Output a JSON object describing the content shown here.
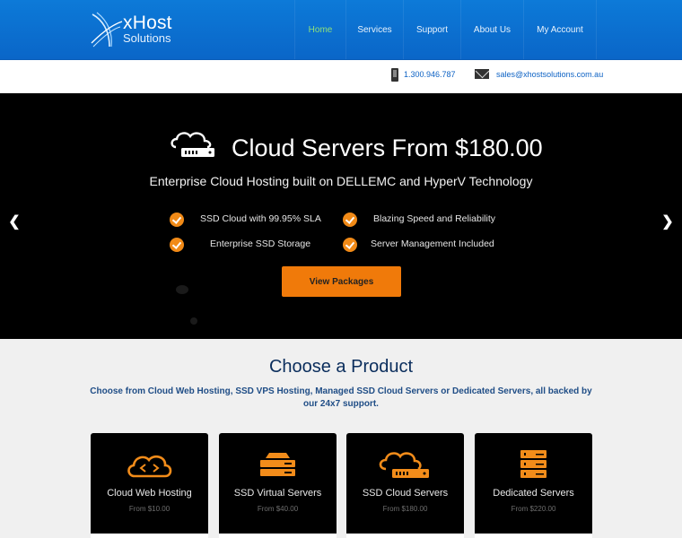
{
  "brand": {
    "name_line1": "xHost",
    "name_line2": "Solutions",
    "logo_icon": "swoosh-logo-icon",
    "primary_color": "#0d72d2",
    "accent_color": "#f07a0a",
    "active_nav_color": "#8fe07a"
  },
  "nav": {
    "items": [
      {
        "label": "Home",
        "active": true
      },
      {
        "label": "Services",
        "active": false
      },
      {
        "label": "Support",
        "active": false
      },
      {
        "label": "About Us",
        "active": false
      },
      {
        "label": "My Account",
        "active": false
      }
    ]
  },
  "contact": {
    "phone": "1.300.946.787",
    "phone_icon": "phone-icon",
    "email": "sales@xhostsolutions.com.au",
    "email_icon": "mail-icon"
  },
  "hero": {
    "icon": "cloud-server-icon",
    "title": "Cloud Servers From $180.00",
    "subtitle": "Enterprise Cloud Hosting built on DELLEMC and HyperV Technology",
    "features": [
      "SSD Cloud with 99.95% SLA",
      "Blazing Speed and Reliability",
      "Enterprise SSD Storage",
      "Server Management Included"
    ],
    "cta_label": "View Packages",
    "prev_icon": "chevron-left-icon",
    "next_icon": "chevron-right-icon"
  },
  "products": {
    "title": "Choose a Product",
    "subtitle": "Choose from Cloud Web Hosting, SSD VPS Hosting, Managed SSD Cloud Servers or Dedicated Servers, all backed by our 24x7 support.",
    "cards": [
      {
        "title": "Cloud Web Hosting",
        "price": "From $10.00",
        "icon": "cloud-code-icon"
      },
      {
        "title": "SSD Virtual Servers",
        "price": "From $40.00",
        "icon": "server-stack-icon"
      },
      {
        "title": "SSD Cloud Servers",
        "price": "From $180.00",
        "icon": "cloud-server-icon"
      },
      {
        "title": "Dedicated Servers",
        "price": "From $220.00",
        "icon": "server-tower-icon"
      }
    ]
  }
}
